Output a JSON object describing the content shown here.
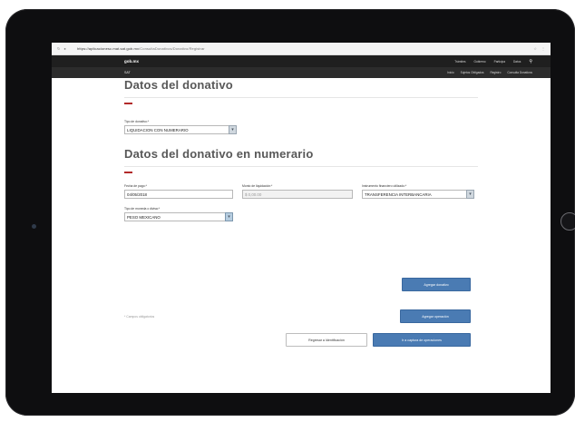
{
  "browser": {
    "url_host": "https://aplicacionesc.mat.sat.gob.mx",
    "url_path": "/ConsultaDonativos/Donativo/Registrar"
  },
  "gob_header": {
    "logo": "gob.mx",
    "links": [
      "Trámites",
      "Gobierno",
      "Participa",
      "Datos"
    ]
  },
  "sat_header": {
    "brand": "SAT",
    "links": [
      "Inicio",
      "Sujetos Obligados",
      "Registro",
      "Consulta Donativos"
    ]
  },
  "section1": {
    "title": "Datos del donativo",
    "tipo_label": "Tipo de donativo:*",
    "tipo_value": "LIQUIDACION CON NUMERARIO"
  },
  "section2": {
    "title": "Datos del donativo en numerario",
    "fecha_label": "Fecha de pago:*",
    "fecha_value": "04/05/2018",
    "monto_label": "Monto de liquidación:*",
    "monto_value": "$ 0,00.00",
    "instrumento_label": "Instrumento financiero utilizado:*",
    "instrumento_value": "TRANSFERENCIA INTERBANCARIA",
    "moneda_label": "Tipo de moneda o divisa:*",
    "moneda_value": "PESO MEXICANO"
  },
  "buttons": {
    "agregar_donativo": "Agregar donativo",
    "agregar_operacion": "Agregar operación",
    "regresar": "Regresar a Identificación",
    "ir_captura": "Ir a captura de operaciones"
  },
  "required_note": "* Campos obligatorios",
  "colors": {
    "accent": "#4a7bb3",
    "header_dark": "#1f1f1f",
    "title_dash": "#b22a2a"
  },
  "icons": {
    "select_arrow": "chevron-down-icon",
    "home_button": "tablet-home-button"
  }
}
